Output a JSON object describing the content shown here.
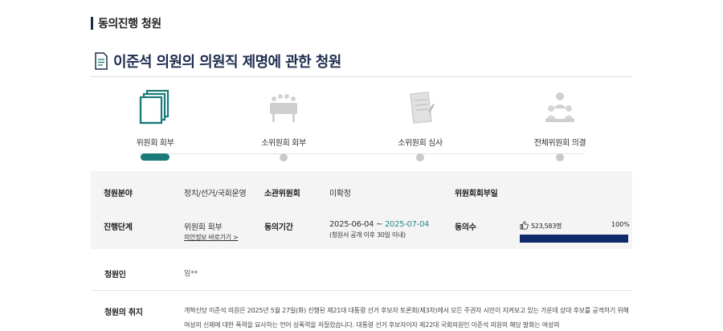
{
  "section_title": "동의진행 청원",
  "petition_title": "이준석 의원의 의원직 제명에 관한 청원",
  "steps": [
    {
      "label": "위원회 회부",
      "icon": "document-stack-icon",
      "active": true
    },
    {
      "label": "소위원회 회부",
      "icon": "meeting-table-icon",
      "active": false
    },
    {
      "label": "소위원회 심사",
      "icon": "review-document-icon",
      "active": false
    },
    {
      "label": "전체위원회 의결",
      "icon": "committee-people-icon",
      "active": false
    }
  ],
  "info": {
    "field_label": "청원분야",
    "field_value": "정치/선거/국회운영",
    "committee_label": "소관위원회",
    "committee_value": "미확정",
    "referral_label": "위원회회부일",
    "referral_value": "",
    "stage_label": "진행단계",
    "stage_value": "위원회 회부",
    "stage_link": "의안정보 바로가기 >",
    "period_label": "동의기간",
    "period_start": "2025-06-04 ~ ",
    "period_end": "2025-07-04",
    "period_note": "(청원서 공개 이후 30일 이내)",
    "agree_label": "동의수",
    "agree_count": "523,583명",
    "agree_percent_text": "100%",
    "agree_progress": 1.0
  },
  "petitioner": {
    "label": "청원인",
    "value": "임**"
  },
  "purpose": {
    "label": "청원의 취지",
    "text": "개혁신당 이준석 의원은 2025년 5월 27일(화) 진행된 제21대 대통령 선거 후보자 토론회(제3차)에서 모든 주권자 시민이 지켜보고 있는 가운데 상대 후보를 공격하기 위해 여성의 신체에 대한 폭력을 묘사하는 언어 성폭력을 저질렀습니다. 대통령 선거 후보자이자 제22대 국회의원인 이준석 의원의 해당 발화는 여성의"
  },
  "colors": {
    "accent": "#1a7a78",
    "progress": "#0e2a6b",
    "title": "#1f2d4f",
    "period_end": "#2a8a8a"
  }
}
